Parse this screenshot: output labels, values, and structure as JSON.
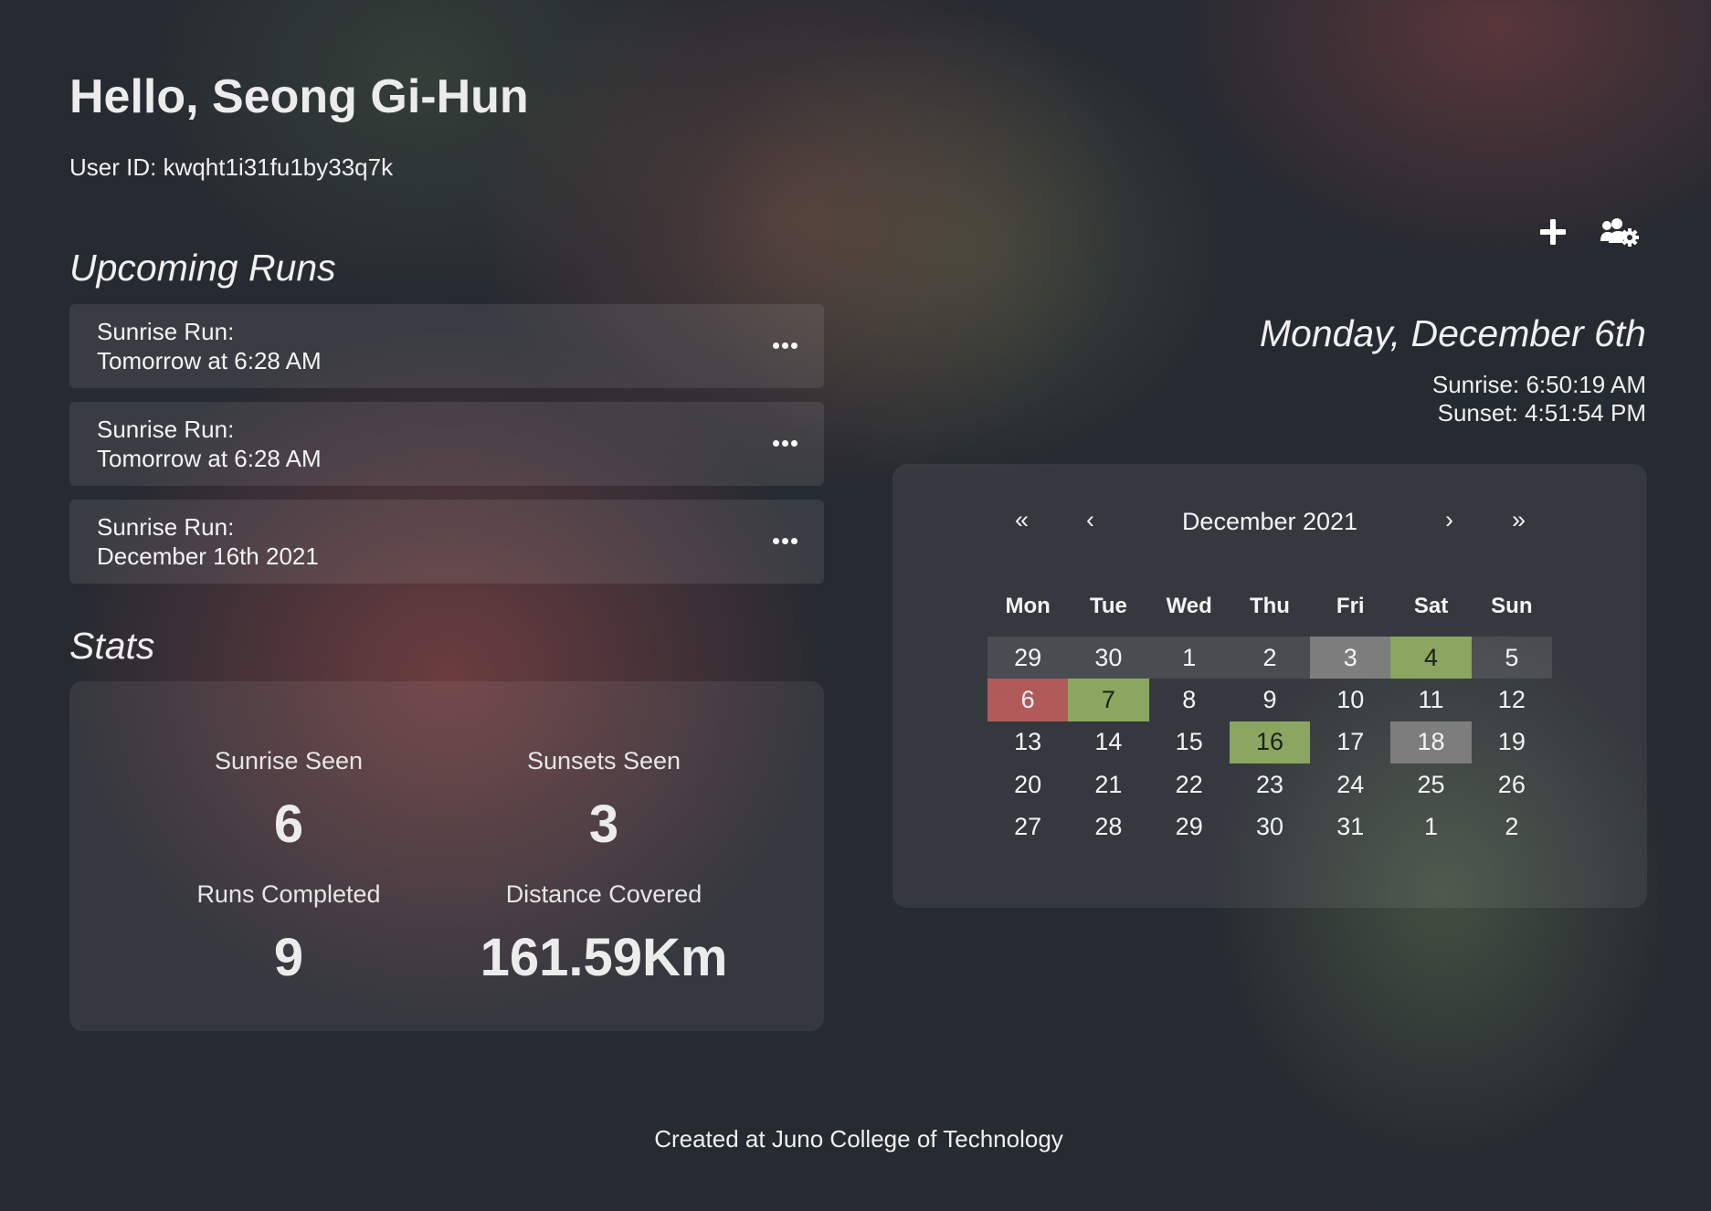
{
  "header": {
    "greeting": "Hello, Seong Gi-Hun",
    "user_id": "User ID: kwqht1i31fu1by33q7k"
  },
  "toolbar": {
    "add_icon": "plus-icon",
    "group_settings_icon": "users-gear-icon"
  },
  "upcoming_runs": {
    "title": "Upcoming Runs",
    "items": [
      {
        "title": "Sunrise Run:",
        "when": "Tomorrow at 6:28 AM"
      },
      {
        "title": "Sunrise Run:",
        "when": "Tomorrow at 6:28 AM"
      },
      {
        "title": "Sunrise Run:",
        "when": "December 16th 2021"
      }
    ]
  },
  "stats": {
    "title": "Stats",
    "sunrise_seen": {
      "label": "Sunrise Seen",
      "value": "6"
    },
    "sunsets_seen": {
      "label": "Sunsets Seen",
      "value": "3"
    },
    "runs_completed": {
      "label": "Runs Completed",
      "value": "9"
    },
    "distance_covered": {
      "label": "Distance Covered",
      "value": "161.59Km"
    }
  },
  "today": {
    "date": "Monday, December 6th",
    "sunrise": "Sunrise: 6:50:19 AM",
    "sunset": "Sunset: 4:51:54 PM"
  },
  "calendar": {
    "month_label": "December 2021",
    "nav": {
      "prev_year": "«",
      "prev_month": "‹",
      "next_month": "›",
      "next_year": "»"
    },
    "weekdays": [
      "Mon",
      "Tue",
      "Wed",
      "Thu",
      "Fri",
      "Sat",
      "Sun"
    ],
    "status_colors": {
      "today": "#b05a5a",
      "sunrise_run": "#8aa660",
      "past": "#7d7d7d"
    },
    "days": [
      {
        "label": "29",
        "status": "adjacent"
      },
      {
        "label": "30",
        "status": "adjacent"
      },
      {
        "label": "1",
        "status": "none"
      },
      {
        "label": "2",
        "status": "none"
      },
      {
        "label": "3",
        "status": "past"
      },
      {
        "label": "4",
        "status": "sunrise_run"
      },
      {
        "label": "5",
        "status": "none"
      },
      {
        "label": "6",
        "status": "today"
      },
      {
        "label": "7",
        "status": "sunrise_run"
      },
      {
        "label": "8",
        "status": "none"
      },
      {
        "label": "9",
        "status": "none"
      },
      {
        "label": "10",
        "status": "none"
      },
      {
        "label": "11",
        "status": "none"
      },
      {
        "label": "12",
        "status": "none"
      },
      {
        "label": "13",
        "status": "none"
      },
      {
        "label": "14",
        "status": "none"
      },
      {
        "label": "15",
        "status": "none"
      },
      {
        "label": "16",
        "status": "sunrise_run"
      },
      {
        "label": "17",
        "status": "none"
      },
      {
        "label": "18",
        "status": "past"
      },
      {
        "label": "19",
        "status": "none"
      },
      {
        "label": "20",
        "status": "none"
      },
      {
        "label": "21",
        "status": "none"
      },
      {
        "label": "22",
        "status": "none"
      },
      {
        "label": "23",
        "status": "none"
      },
      {
        "label": "24",
        "status": "none"
      },
      {
        "label": "25",
        "status": "none"
      },
      {
        "label": "26",
        "status": "none"
      },
      {
        "label": "27",
        "status": "none"
      },
      {
        "label": "28",
        "status": "none"
      },
      {
        "label": "29",
        "status": "none"
      },
      {
        "label": "30",
        "status": "none"
      },
      {
        "label": "31",
        "status": "none"
      },
      {
        "label": "1",
        "status": "adjacent"
      },
      {
        "label": "2",
        "status": "adjacent"
      }
    ]
  },
  "footer": {
    "text": "Created at Juno College of Technology"
  }
}
